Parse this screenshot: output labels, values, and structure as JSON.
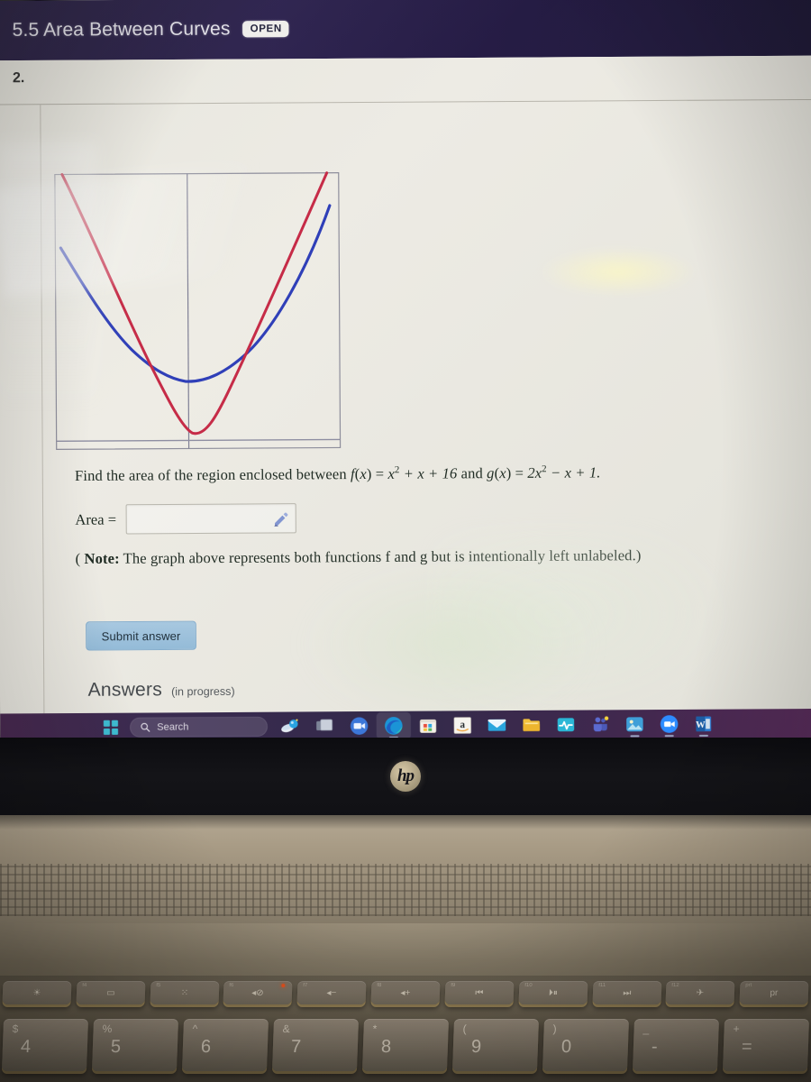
{
  "header": {
    "title": "5.5 Area Between Curves",
    "badge": "OPEN"
  },
  "problem": {
    "number": "2.",
    "prompt_plain": "Find the area of the region enclosed between f(x) = x² + x + 16 and g(x) = 2x² − x + 1.",
    "prompt_lead": "Find the area of the region enclosed between ",
    "f_name": "f",
    "f_open": "(",
    "f_var": "x",
    "f_close": ")",
    "f_eq": " = ",
    "f_body_base": "x",
    "f_body_exp": "2",
    "f_body_rest": " + x + 16",
    "conj": " and ",
    "g_name": "g",
    "g_body_coeff": "2x",
    "g_body_exp": "2",
    "g_body_rest": " − x + 1.",
    "area_label": "Area =",
    "answer_value": "",
    "answer_placeholder": "",
    "note_open": "( ",
    "note_bold": "Note:",
    "note_text": " The graph above represents both functions f and g but is intentionally left unlabeled.)",
    "submit_label": "Submit answer"
  },
  "answers_section": {
    "title": "Answers",
    "status": "(in progress)"
  },
  "chart_data": {
    "type": "line",
    "title": "",
    "xlabel": "",
    "ylabel": "",
    "xlim": [
      -6.2,
      6.2
    ],
    "ylim": [
      -2,
      60
    ],
    "grid": false,
    "axes": {
      "x_axis_visible": true,
      "y_axis_visible": true,
      "border": true
    },
    "legend": "none",
    "series": [
      {
        "name": "f(x) = x^2 + x + 16",
        "color": "#2f3fb8",
        "equation": "x^2 + x + 16",
        "x": [
          -6,
          -5,
          -4,
          -3,
          -2,
          -1,
          0,
          1,
          2,
          3,
          4,
          5,
          6
        ],
        "y": [
          46,
          36,
          28,
          22,
          18,
          16,
          16,
          18,
          22,
          28,
          36,
          46,
          58
        ]
      },
      {
        "name": "g(x) = 2x^2 - x + 1",
        "color": "#c62b47",
        "equation": "2x^2 - x + 1",
        "x": [
          -6,
          -5,
          -4,
          -3,
          -2,
          -1,
          0,
          1,
          2,
          3,
          4,
          5,
          6
        ],
        "y": [
          79,
          56,
          37,
          22,
          11,
          4,
          1,
          2,
          7,
          16,
          29,
          46,
          67
        ]
      }
    ],
    "intersections": [
      {
        "x": -3,
        "y": 22
      },
      {
        "x": 5,
        "y": 46
      }
    ]
  },
  "taskbar": {
    "start_label": "Start",
    "search_placeholder": "Search",
    "items": [
      {
        "name": "start-button",
        "icon": "windows-logo-icon",
        "label": "Start"
      },
      {
        "name": "search-box",
        "icon": "search-icon",
        "label": "Search"
      },
      {
        "name": "copilot",
        "icon": "copilot-icon",
        "label": "Copilot"
      },
      {
        "name": "task-view",
        "icon": "task-view-icon",
        "label": "Task View"
      },
      {
        "name": "camera",
        "icon": "camera-icon",
        "label": "Camera"
      },
      {
        "name": "edge",
        "icon": "edge-browser-icon",
        "label": "Microsoft Edge",
        "active": true
      },
      {
        "name": "store",
        "icon": "microsoft-store-icon",
        "label": "Microsoft Store"
      },
      {
        "name": "amazon",
        "icon": "amazon-icon",
        "label": "Amazon"
      },
      {
        "name": "mail",
        "icon": "mail-icon",
        "label": "Mail"
      },
      {
        "name": "file-explorer",
        "icon": "file-explorer-icon",
        "label": "File Explorer"
      },
      {
        "name": "pulse-app",
        "icon": "pulse-icon",
        "label": "Pulse"
      },
      {
        "name": "teams",
        "icon": "teams-icon",
        "label": "Microsoft Teams",
        "active": true
      },
      {
        "name": "photos",
        "icon": "photos-icon",
        "label": "Photos",
        "active": true
      },
      {
        "name": "zoom",
        "icon": "zoom-icon",
        "label": "Zoom",
        "active": true
      },
      {
        "name": "word",
        "icon": "word-icon",
        "label": "Microsoft Word",
        "active": true
      }
    ]
  },
  "laptop": {
    "brand": "hp"
  },
  "keyboard": {
    "function_keys": [
      {
        "sup": "",
        "glyph": "☀"
      },
      {
        "sup": "f4",
        "glyph": "▭"
      },
      {
        "sup": "f5",
        "glyph": "⁙"
      },
      {
        "sup": "f6",
        "glyph": "◂⊘",
        "led": true
      },
      {
        "sup": "f7",
        "glyph": "◂−"
      },
      {
        "sup": "f8",
        "glyph": "◂+"
      },
      {
        "sup": "f9",
        "glyph": "⏮"
      },
      {
        "sup": "f10",
        "glyph": "⏵⏸"
      },
      {
        "sup": "f11",
        "glyph": "⏭"
      },
      {
        "sup": "f12",
        "glyph": "✈"
      },
      {
        "sup": "prt",
        "glyph": "pr"
      }
    ],
    "number_keys": [
      {
        "top": "$",
        "main": "4"
      },
      {
        "top": "%",
        "main": "5"
      },
      {
        "top": "^",
        "main": "6"
      },
      {
        "top": "&",
        "main": "7"
      },
      {
        "top": "*",
        "main": "8"
      },
      {
        "top": "(",
        "main": "9"
      },
      {
        "top": ")",
        "main": "0"
      },
      {
        "top": "_",
        "main": "-"
      },
      {
        "top": "+",
        "main": "="
      }
    ]
  },
  "colors": {
    "header_bg": "#241a3f",
    "curve_f": "#2f3fb8",
    "curve_g": "#c62b47",
    "submit_bg": "#98c0dc",
    "taskbar_bg": "#3a2b50",
    "page_bg": "#edebe4"
  }
}
